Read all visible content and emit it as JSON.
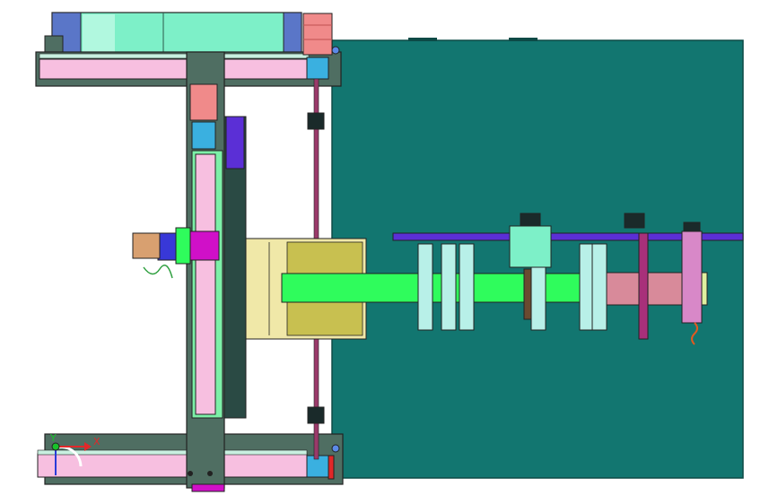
{
  "viewport": {
    "background": "#ffffff",
    "plate_color": "#127670",
    "frame_color": "#4f6e62",
    "rail_color": "#f7bfe0",
    "accent_blue": "#5b2fd6",
    "accent_green": "#2ffc5c",
    "magenta": "#d010c8"
  },
  "triad": {
    "x_label": "X",
    "y_label": "Y",
    "x_color": "#e0282a",
    "y_color": "#18c22a",
    "z_color": "#2a3bd8"
  },
  "icons": [
    "coordinate-triad-icon"
  ]
}
